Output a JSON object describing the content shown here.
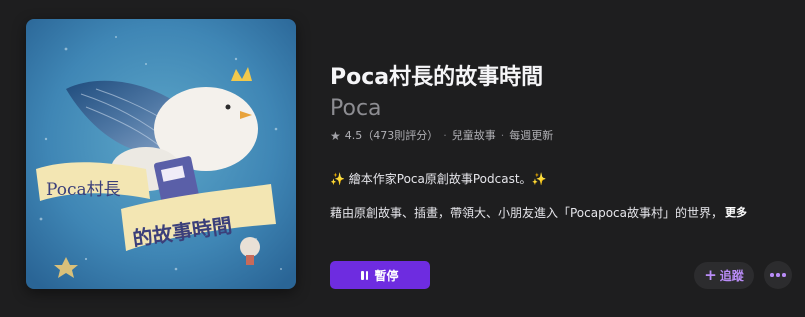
{
  "podcast": {
    "title": "Poca村長的故事時間",
    "provider": "Poca",
    "rating": "4.5",
    "rating_count": "（473則評分）",
    "category": "兒童故事",
    "frequency": "每週更新",
    "description_line1": "✨ 繪本作家Poca原創故事Podcast。✨",
    "description_line2": "藉由原創故事、插畫，帶領大、小朋友進入「Pocapoca故事村」的世界，",
    "more_label": "更多"
  },
  "artwork": {
    "banner_line1": "Poca村長",
    "banner_line2": "的故事時間"
  },
  "actions": {
    "pause_label": "暫停",
    "follow_label": "追蹤"
  },
  "colors": {
    "accent": "#6e2ce0",
    "accent_text": "#b98cf7",
    "background": "#1e1e1f"
  },
  "icons": {
    "rating": "star-icon",
    "pause": "pause-icon",
    "follow": "plus-icon",
    "more": "ellipsis-icon"
  }
}
